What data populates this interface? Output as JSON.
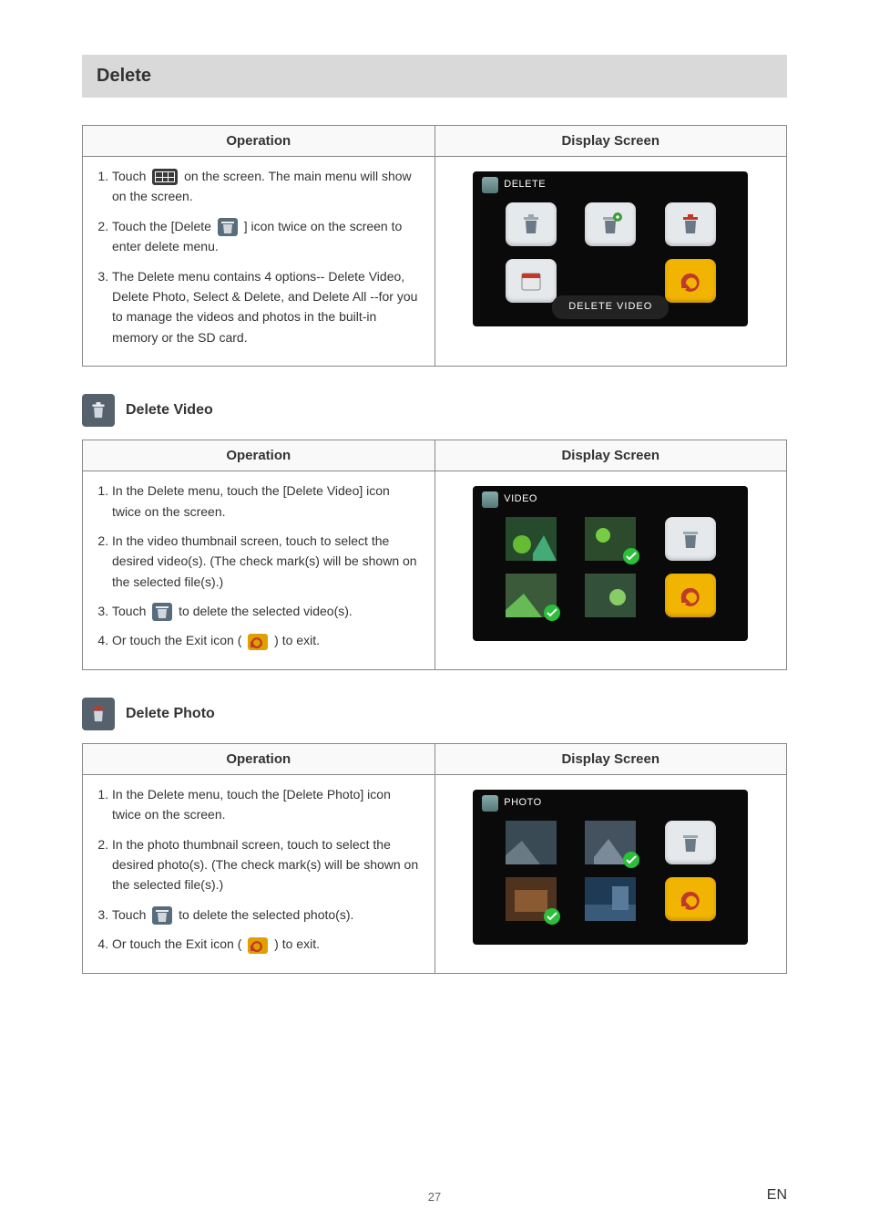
{
  "section_title": "Delete",
  "table_headers": {
    "operation": "Operation",
    "display": "Display Screen"
  },
  "delete_menu": {
    "screen_label": "DELETE",
    "caption": "DELETE VIDEO",
    "steps": [
      "Touch {grid} on the screen. The main menu will show on the screen.",
      "Touch the [Delete {trash} ] icon twice on the screen to enter delete menu.",
      "The Delete menu contains 4 options-- Delete Video, Delete Photo, Select & Delete, and Delete All --for you to manage the videos and photos in the built-in memory or the SD card."
    ]
  },
  "delete_video": {
    "title": "Delete Video",
    "screen_label": "VIDEO",
    "steps": [
      "In the Delete menu, touch the [Delete Video] icon twice on the screen.",
      "In the video thumbnail screen, touch to select the desired video(s). (The check mark(s) will be shown on the selected file(s).)",
      "Touch {trash} to delete the selected video(s).",
      "Or touch the Exit icon ( {exit} ) to exit."
    ]
  },
  "delete_photo": {
    "title": "Delete Photo",
    "screen_label": "PHOTO",
    "steps": [
      "In the Delete menu, touch the [Delete Photo] icon twice on the screen.",
      "In the photo thumbnail screen, touch to select the desired photo(s). (The check mark(s) will be shown on the selected file(s).)",
      "Touch {trash} to delete the selected photo(s).",
      "Or touch the Exit icon ( {exit} ) to exit."
    ]
  },
  "page_number": "27",
  "lang": "EN"
}
